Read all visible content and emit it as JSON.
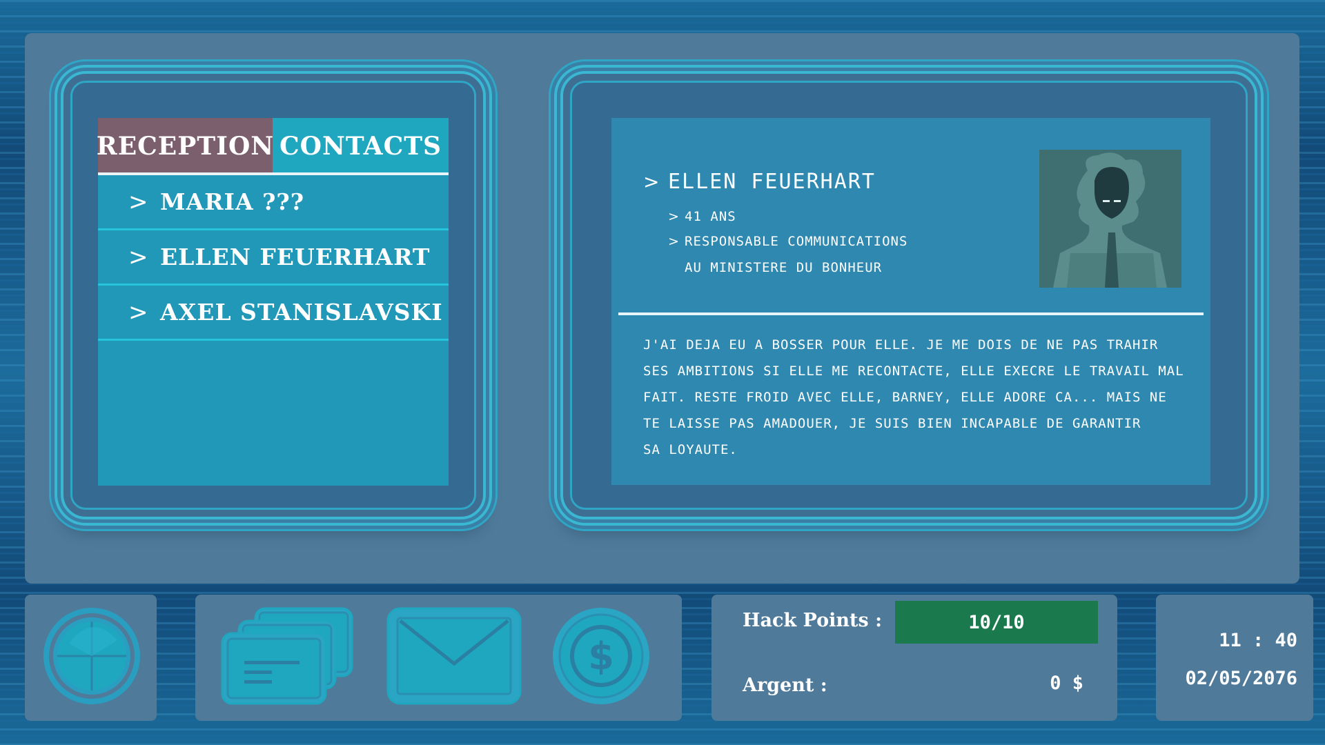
{
  "tabs": {
    "reception": "RECEPTION",
    "contacts": "CONTACTS",
    "active": "reception"
  },
  "messages": [
    {
      "name": "MARIA ???"
    },
    {
      "name": "ELLEN FEUERHART"
    },
    {
      "name": "AXEL STANISLAVSKI"
    }
  ],
  "detail": {
    "name": "ELLEN FEUERHART",
    "age": "41 ANS",
    "role_line1": "RESPONSABLE COMMUNICATIONS",
    "role_line2": "AU MINISTERE DU BONHEUR",
    "bio": [
      "J'AI DEJA EU A BOSSER POUR ELLE. JE ME DOIS DE NE PAS TRAHIR",
      "SES AMBITIONS SI ELLE ME RECONTACTE, ELLE EXECRE LE TRAVAIL MAL",
      "FAIT. RESTE FROID AVEC ELLE, BARNEY, ELLE ADORE CA... MAIS NE",
      "TE LAISSE PAS AMADOUER, JE SUIS BIEN INCAPABLE DE GARANTIR",
      "SA LOYAUTE."
    ]
  },
  "toolbar": {
    "icons": [
      "radar-icon",
      "cards-icon",
      "mail-icon",
      "coin-icon"
    ]
  },
  "stats": {
    "hack_label": "Hack Points :",
    "hack_value": "10/10",
    "hack_fraction": 1.0,
    "money_label": "Argent :",
    "money_value": "0 $"
  },
  "clock": {
    "time": "11 : 40",
    "date": "02/05/2076"
  },
  "colors": {
    "accent": "#1fa7c0",
    "tab_active": "#7c5f6c",
    "hack_bar": "#1a7a4e",
    "panel": "#4f7a9a"
  }
}
